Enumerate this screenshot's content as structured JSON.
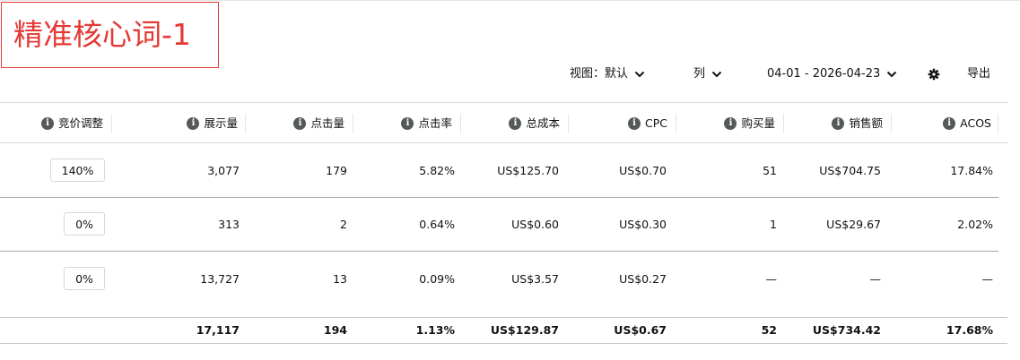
{
  "title": "精准核心词-1",
  "toolbar": {
    "view_label": "视图：默认",
    "columns_label": "列",
    "date_range": "04-01 - 2026-04-23",
    "export_label": "导出",
    "settings_icon": "gear-icon"
  },
  "columns": [
    {
      "label": "竞价调整",
      "icon": "info-icon"
    },
    {
      "label": "展示量",
      "icon": "info-icon"
    },
    {
      "label": "点击量",
      "icon": "info-icon"
    },
    {
      "label": "点击率",
      "icon": "info-icon"
    },
    {
      "label": "总成本",
      "icon": "info-icon"
    },
    {
      "label": "CPC",
      "icon": "info-icon"
    },
    {
      "label": "购买量",
      "icon": "info-icon"
    },
    {
      "label": "销售额",
      "icon": "info-icon"
    },
    {
      "label": "ACOS",
      "icon": "info-icon"
    }
  ],
  "rows": [
    {
      "bid": "140%",
      "impressions": "3,077",
      "clicks": "179",
      "ctr": "5.82%",
      "cost": "US$125.70",
      "cpc": "US$0.70",
      "purchases": "51",
      "sales": "US$704.75",
      "acos": "17.84%"
    },
    {
      "bid": "0%",
      "impressions": "313",
      "clicks": "2",
      "ctr": "0.64%",
      "cost": "US$0.60",
      "cpc": "US$0.30",
      "purchases": "1",
      "sales": "US$29.67",
      "acos": "2.02%"
    },
    {
      "bid": "0%",
      "impressions": "13,727",
      "clicks": "13",
      "ctr": "0.09%",
      "cost": "US$3.57",
      "cpc": "US$0.27",
      "purchases": "—",
      "sales": "—",
      "acos": "—"
    }
  ],
  "totals": {
    "impressions": "17,117",
    "clicks": "194",
    "ctr": "1.13%",
    "cost": "US$129.87",
    "cpc": "US$0.67",
    "purchases": "52",
    "sales": "US$734.42",
    "acos": "17.68%"
  },
  "colors": {
    "title_red": "#e53935",
    "link_blue": "#0f6b8c",
    "info_icon": "#565959"
  }
}
